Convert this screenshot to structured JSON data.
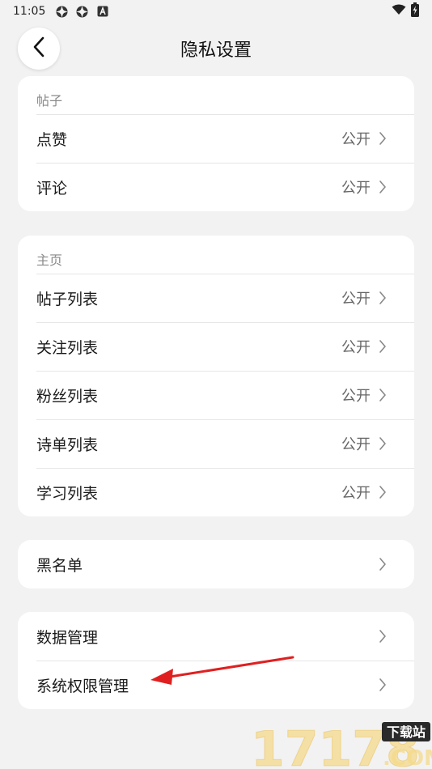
{
  "status_bar": {
    "time": "11:05",
    "icons": [
      "sync-icon",
      "sync-icon",
      "text-a-icon"
    ],
    "right_icons": [
      "wifi-icon",
      "battery-charging-icon"
    ]
  },
  "header": {
    "back_icon": "chevron-left-icon",
    "title": "隐私设置"
  },
  "sections": {
    "posts": {
      "label": "帖子",
      "rows": [
        {
          "label": "点赞",
          "value": "公开"
        },
        {
          "label": "评论",
          "value": "公开"
        }
      ]
    },
    "homepage": {
      "label": "主页",
      "rows": [
        {
          "label": "帖子列表",
          "value": "公开"
        },
        {
          "label": "关注列表",
          "value": "公开"
        },
        {
          "label": "粉丝列表",
          "value": "公开"
        },
        {
          "label": "诗单列表",
          "value": "公开"
        },
        {
          "label": "学习列表",
          "value": "公开"
        }
      ]
    },
    "blacklist": {
      "rows": [
        {
          "label": "黑名单"
        }
      ]
    },
    "data": {
      "rows": [
        {
          "label": "数据管理"
        },
        {
          "label": "系统权限管理"
        }
      ]
    }
  },
  "annotation": {
    "arrow_color": "#e02020",
    "icon": "red-arrow-pointer"
  },
  "watermark": {
    "text": "17178",
    "badge": "下载站",
    "domain": ".COM"
  },
  "colors": {
    "background": "#f2f2f2",
    "card": "#ffffff",
    "section_label": "#8a8a8a",
    "value_text": "#666666"
  }
}
